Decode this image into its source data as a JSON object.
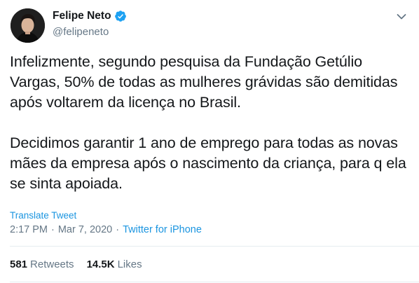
{
  "author": {
    "display_name": "Felipe Neto",
    "handle": "@felipeneto",
    "verified": true
  },
  "tweet": {
    "paragraphs": [
      "Infelizmente, segundo pesquisa da Fundação Getúlio Vargas, 50% de todas as mulheres grávidas são demitidas após voltarem da licença no Brasil.",
      "Decidimos garantir 1 ano de emprego para todas as novas mães da empresa após o nascimento da criança, para q ela se sinta apoiada."
    ],
    "translate_label": "Translate Tweet",
    "time": "2:17 PM",
    "date": "Mar 7, 2020",
    "separator": "·",
    "source": "Twitter for iPhone"
  },
  "stats": {
    "retweets_count": "581",
    "retweets_label": "Retweets",
    "likes_count": "14.5K",
    "likes_label": "Likes"
  },
  "colors": {
    "link": "#1b95e0",
    "muted": "#657786",
    "text": "#14171a",
    "verified": "#1da1f2"
  },
  "icons": {
    "verified": "verified-badge-icon",
    "caret": "chevron-down-icon"
  }
}
